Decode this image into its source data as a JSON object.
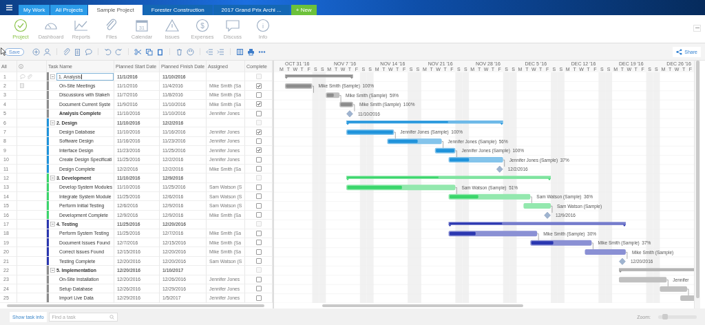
{
  "top_bar": {
    "tabs": [
      {
        "label": "My Work",
        "kind": "view",
        "selected": false
      },
      {
        "label": "All Projects",
        "kind": "view",
        "selected": false
      },
      {
        "label": "Sample Project",
        "kind": "project",
        "selected": true
      },
      {
        "label": "Forester Construction",
        "kind": "project",
        "selected": false
      },
      {
        "label": "2017 Grand Prix Archi ...",
        "kind": "project",
        "selected": false
      },
      {
        "label": "+ New",
        "kind": "new",
        "selected": false
      }
    ]
  },
  "nav": {
    "items": [
      {
        "label": "Project",
        "kind": "project",
        "selected": true
      },
      {
        "label": "Dashboard",
        "kind": "dashboard",
        "selected": false
      },
      {
        "label": "Reports",
        "kind": "reports",
        "selected": false
      },
      {
        "label": "Files",
        "kind": "files",
        "selected": false
      },
      {
        "label": "Calendar",
        "kind": "calendar",
        "glyph": "31",
        "selected": false
      },
      {
        "label": "Issues",
        "kind": "issues",
        "selected": false
      },
      {
        "label": "Expenses",
        "kind": "expenses",
        "glyph": "$",
        "selected": false
      },
      {
        "label": "Discuss",
        "kind": "discuss",
        "selected": false
      },
      {
        "label": "Info",
        "kind": "info",
        "glyph": "i",
        "selected": false
      }
    ]
  },
  "toolbar": {
    "save": "Save",
    "share": "Share"
  },
  "grid": {
    "columns": {
      "all": "All",
      "name": "Task Name",
      "start": "Planned Start Date",
      "finish": "Planned Finish Date",
      "assigned": "Assigned",
      "complete": "Complete"
    },
    "rows": [
      {
        "num": "1",
        "kind": "summary",
        "name": "1. Analysis",
        "start": "11/1/2016",
        "finish": "11/10/2016",
        "checked": false,
        "disabled": true,
        "expanded": true,
        "color": "#8c8c8c",
        "editing": true,
        "bold": false,
        "level": 1,
        "indicators": [
          {
            "kind": "comment"
          },
          {
            "kind": "attachment"
          }
        ]
      },
      {
        "num": "2",
        "kind": "task",
        "name": "On-Site Meetings",
        "start": "11/1/2016",
        "finish": "11/4/2016",
        "assigned": "Mike Smith (Sa",
        "checked": true,
        "disabled": false,
        "bold": false,
        "level": 1,
        "bar_label": "Mike Smith (Sample)  100%",
        "indicators": [
          {
            "kind": "document"
          }
        ]
      },
      {
        "num": "3",
        "kind": "task",
        "name": "Discussions with Stakeh",
        "start": "11/7/2016",
        "finish": "11/8/2016",
        "assigned": "Mike Smith (Sa",
        "checked": false,
        "disabled": false,
        "bold": false,
        "level": 0.59,
        "bar_label": "Mike Smith (Sample)  59%"
      },
      {
        "num": "4",
        "kind": "task",
        "name": "Document Current Syste",
        "start": "11/9/2016",
        "finish": "11/10/2016",
        "assigned": "Mike Smith (Sa",
        "checked": true,
        "disabled": false,
        "bold": false,
        "level": 1,
        "bar_label": "Mike Smith (Sample)  100%"
      },
      {
        "num": "5",
        "kind": "milestone",
        "name": "Analysis Complete",
        "start": "11/10/2016",
        "finish": "11/10/2016",
        "assigned": "Jennifer Jones",
        "checked": false,
        "disabled": false,
        "bold": true,
        "bar_label": "11/10/2016"
      },
      {
        "num": "6",
        "kind": "summary",
        "name": "2. Design",
        "start": "11/10/2016",
        "finish": "12/2/2016",
        "checked": false,
        "disabled": true,
        "expanded": true,
        "color": "#1f93db",
        "editing": false,
        "bold": true,
        "level": 0.65
      },
      {
        "num": "7",
        "kind": "task",
        "name": "Design Database",
        "start": "11/10/2016",
        "finish": "11/16/2016",
        "assigned": "Jennifer Jones",
        "checked": true,
        "disabled": false,
        "bold": false,
        "level": 1,
        "bar_label": "Jennifer Jones (Sample)  100%"
      },
      {
        "num": "8",
        "kind": "task",
        "name": "Software Design",
        "start": "11/16/2016",
        "finish": "11/23/2016",
        "assigned": "Jennifer Jones",
        "checked": false,
        "disabled": false,
        "bold": false,
        "level": 0.56,
        "bar_label": "Jennifer Jones (Sample)  56%"
      },
      {
        "num": "9",
        "kind": "task",
        "name": "Interface Design",
        "start": "11/23/2016",
        "finish": "11/25/2016",
        "assigned": "Jennifer Jones",
        "checked": true,
        "disabled": false,
        "bold": false,
        "level": 1,
        "bar_label": "Jennifer Jones (Sample)  100%"
      },
      {
        "num": "10",
        "kind": "task",
        "name": "Create Design Specificati",
        "start": "11/25/2016",
        "finish": "12/2/2016",
        "assigned": "Jennifer Jones",
        "checked": false,
        "disabled": false,
        "bold": false,
        "level": 0.37,
        "bar_label": "Jennifer Jones (Sample)  37%"
      },
      {
        "num": "11",
        "kind": "milestone",
        "name": "Design Complete",
        "start": "12/2/2016",
        "finish": "12/2/2016",
        "assigned": "Mike Smith (Sa",
        "checked": false,
        "disabled": false,
        "bold": false,
        "bar_label": "12/2/2016"
      },
      {
        "num": "12",
        "kind": "summary",
        "name": "3. Development",
        "start": "11/10/2016",
        "finish": "12/9/2016",
        "checked": false,
        "disabled": true,
        "expanded": true,
        "color": "#3ad66b",
        "editing": false,
        "bold": true,
        "level": 0.45
      },
      {
        "num": "13",
        "kind": "task",
        "name": "Develop System Modules",
        "start": "11/10/2016",
        "finish": "11/25/2016",
        "assigned": "Sam Watson (S",
        "checked": false,
        "disabled": false,
        "bold": false,
        "level": 0.51,
        "bar_label": "Sam Watson (Sample)  51%"
      },
      {
        "num": "14",
        "kind": "task",
        "name": "Integrate System Module",
        "start": "11/25/2016",
        "finish": "12/6/2016",
        "assigned": "Sam Watson (S",
        "checked": false,
        "disabled": false,
        "bold": false,
        "level": 0.36,
        "bar_label": "Sam Watson (Sample)  36%"
      },
      {
        "num": "15",
        "kind": "task",
        "name": "Perform Initial Testing",
        "start": "12/6/2016",
        "finish": "12/9/2016",
        "assigned": "Sam Watson (S",
        "checked": false,
        "disabled": false,
        "bold": false,
        "level": 0,
        "bar_label": "Sam Watson (Sample)"
      },
      {
        "num": "16",
        "kind": "milestone",
        "name": "Development Complete",
        "start": "12/9/2016",
        "finish": "12/9/2016",
        "assigned": "Mike Smith (Sa",
        "checked": false,
        "disabled": false,
        "bold": false,
        "bar_label": "12/9/2016"
      },
      {
        "num": "17",
        "kind": "summary",
        "name": "4. Testing",
        "start": "11/25/2016",
        "finish": "12/20/2016",
        "checked": false,
        "disabled": true,
        "expanded": true,
        "color": "#2a36b0",
        "editing": false,
        "bold": true,
        "level": 0.3
      },
      {
        "num": "18",
        "kind": "task",
        "name": "Perform System Testing",
        "start": "11/25/2016",
        "finish": "12/7/2016",
        "assigned": "Mike Smith (Sa",
        "checked": false,
        "disabled": false,
        "bold": false,
        "level": 0.3,
        "bar_label": "Mike Smith (Sample)  30%"
      },
      {
        "num": "19",
        "kind": "task",
        "name": "Document Issues Found",
        "start": "12/7/2016",
        "finish": "12/15/2016",
        "assigned": "Mike Smith (Sa",
        "checked": false,
        "disabled": false,
        "bold": false,
        "level": 0.37,
        "bar_label": "Mike Smith (Sample)  37%"
      },
      {
        "num": "20",
        "kind": "task",
        "name": "Correct Issues Found",
        "start": "12/15/2016",
        "finish": "12/20/2016",
        "assigned": "Mike Smith (Sa",
        "checked": false,
        "disabled": false,
        "bold": false,
        "level": 0,
        "bar_label": "Mike Smith (Sample)"
      },
      {
        "num": "21",
        "kind": "milestone",
        "name": "Testing Complete",
        "start": "12/20/2016",
        "finish": "12/20/2016",
        "assigned": "Sam Watson (S",
        "checked": false,
        "disabled": false,
        "bold": false,
        "bar_label": "12/20/2016"
      },
      {
        "num": "22",
        "kind": "summary",
        "name": "5. Implementation",
        "start": "12/20/2016",
        "finish": "1/10/2017",
        "checked": false,
        "disabled": true,
        "expanded": true,
        "color": "#8c8c8c",
        "editing": false,
        "bold": true,
        "level": 0
      },
      {
        "num": "23",
        "kind": "task",
        "name": "On-Site Installation",
        "start": "12/20/2016",
        "finish": "12/26/2016",
        "assigned": "Jennifer Jones",
        "checked": false,
        "disabled": false,
        "bold": false,
        "level": 0,
        "bar_label": "Jennifer"
      },
      {
        "num": "24",
        "kind": "task",
        "name": "Setup Database",
        "start": "12/26/2016",
        "finish": "12/29/2016",
        "assigned": "Jennifer Jones",
        "checked": false,
        "disabled": false,
        "bold": false,
        "level": 0
      },
      {
        "num": "25",
        "kind": "task",
        "name": "Import Live Data",
        "start": "12/29/2016",
        "finish": "1/5/2017",
        "assigned": "Jennifer Jones",
        "checked": false,
        "disabled": false,
        "bold": false,
        "level": 0
      }
    ]
  },
  "timeline": {
    "weeks": [
      "OCT 31 '16",
      "NOV 7 '16",
      "NOV 14 '16",
      "NOV 21 '16",
      "NOV 28 '16",
      "DEC 5 '16",
      "DEC 12 '16",
      "DEC 19 '16",
      "DEC 26 '16"
    ],
    "days": [
      "M",
      "T",
      "W",
      "T",
      "F",
      "S",
      "S",
      "M",
      "T",
      "W",
      "T",
      "F",
      "S",
      "S",
      "M",
      "T",
      "W",
      "T",
      "F",
      "S",
      "S",
      "M",
      "T",
      "W",
      "T",
      "F",
      "S",
      "S",
      "M",
      "T",
      "W",
      "T",
      "F",
      "S",
      "S",
      "M",
      "T",
      "W",
      "T",
      "F",
      "S",
      "S",
      "M",
      "T",
      "W",
      "T",
      "F",
      "S",
      "S",
      "M",
      "T",
      "W",
      "T",
      "F",
      "S",
      "S",
      "M",
      "T",
      "W",
      "T",
      "F"
    ]
  },
  "footer": {
    "task_info": "Show task info",
    "find_placeholder": "Find a task",
    "zoom_label": "Zoom:",
    "zoom": {
      "level": 0.1
    }
  }
}
